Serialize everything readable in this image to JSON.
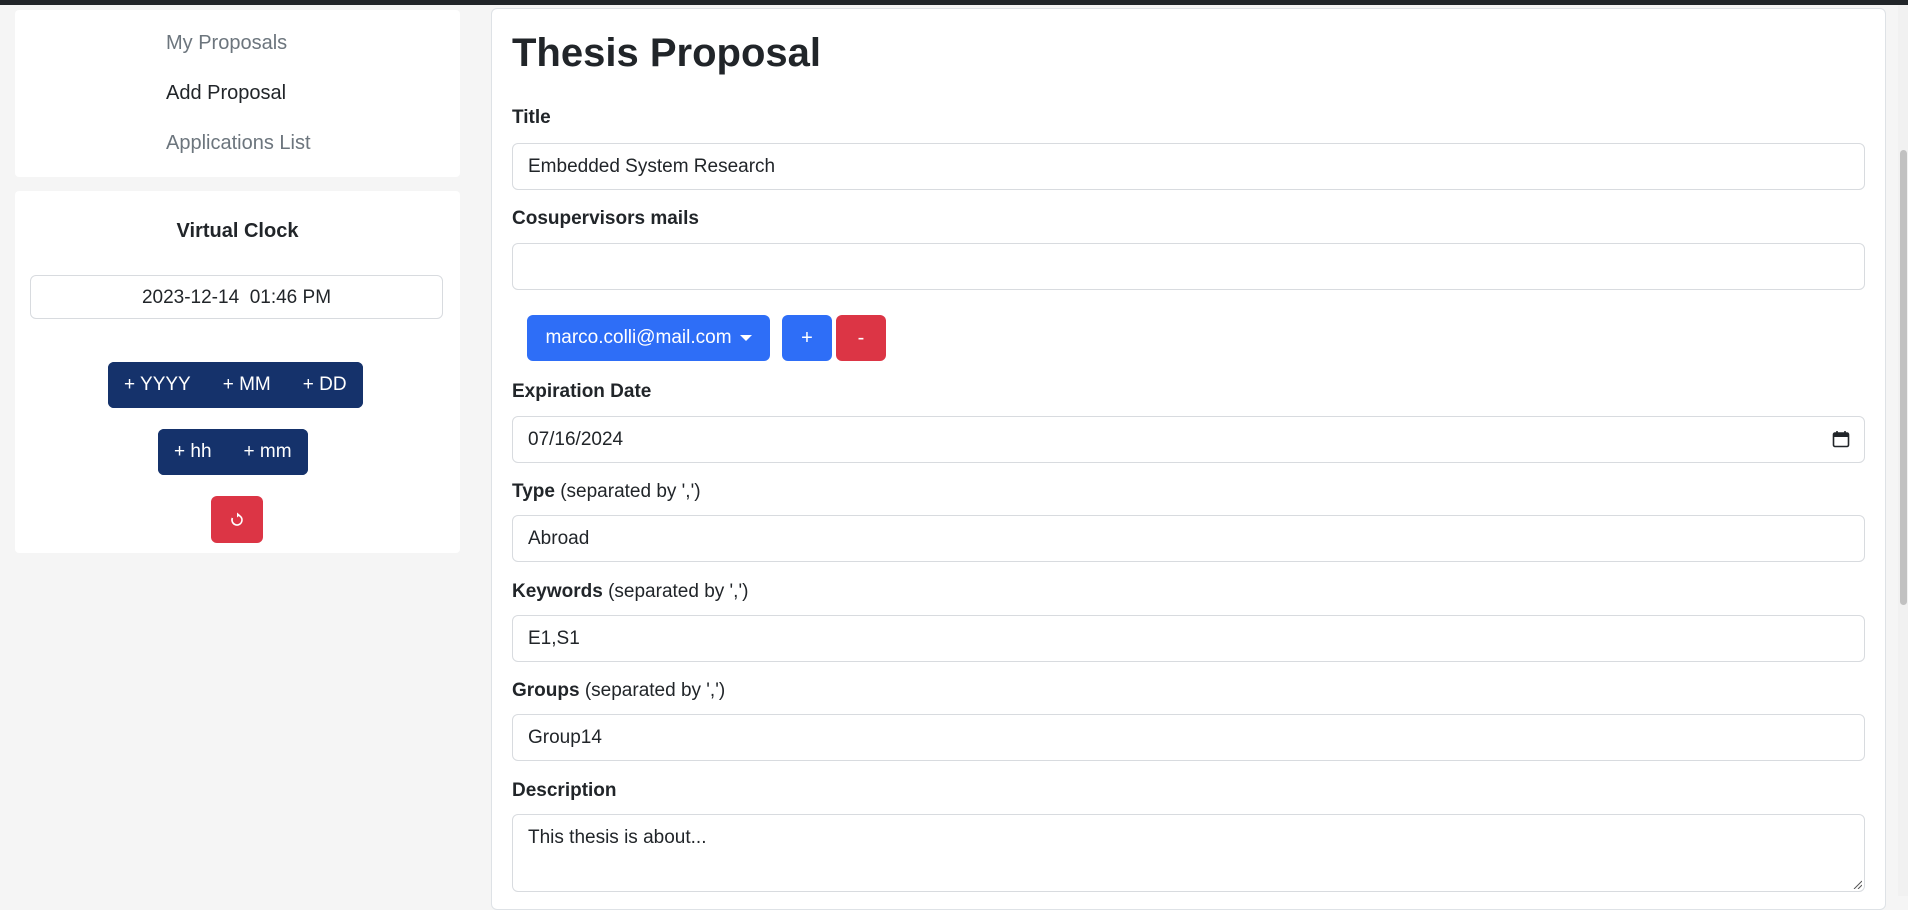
{
  "sidebar": {
    "nav": [
      {
        "label": "My Proposals"
      },
      {
        "label": "Add Proposal"
      },
      {
        "label": "Applications List"
      }
    ],
    "clock": {
      "title": "Virtual Clock",
      "value": "2023-12-14  01:46 PM",
      "buttons_row1": [
        "+ YYYY",
        "+ MM",
        "+ DD"
      ],
      "buttons_row2": [
        "+ hh",
        "+ mm"
      ],
      "reset_icon": "reset-icon"
    }
  },
  "form": {
    "heading": "Thesis Proposal",
    "title_label": "Title",
    "title_value": "Embedded System Research",
    "cosupervisors_label": "Cosupervisors mails",
    "cosupervisors_value": "",
    "cosupervisor_selected": "marco.colli@mail.com",
    "add_label": "+",
    "remove_label": "-",
    "expiration_label": "Expiration Date",
    "expiration_value": "07/16/2024",
    "type_label": "Type",
    "type_hint": " (separated by ',')",
    "type_value": "Abroad",
    "keywords_label": "Keywords",
    "keywords_hint": " (separated by ',')",
    "keywords_value": "E1,S1",
    "groups_label": "Groups",
    "groups_hint": " (separated by ',')",
    "groups_value": "Group14",
    "description_label": "Description",
    "description_value": "This thesis is about..."
  },
  "colors": {
    "primary": "#2e6ef7",
    "danger": "#dc3545",
    "dark_navy": "#15326b"
  }
}
